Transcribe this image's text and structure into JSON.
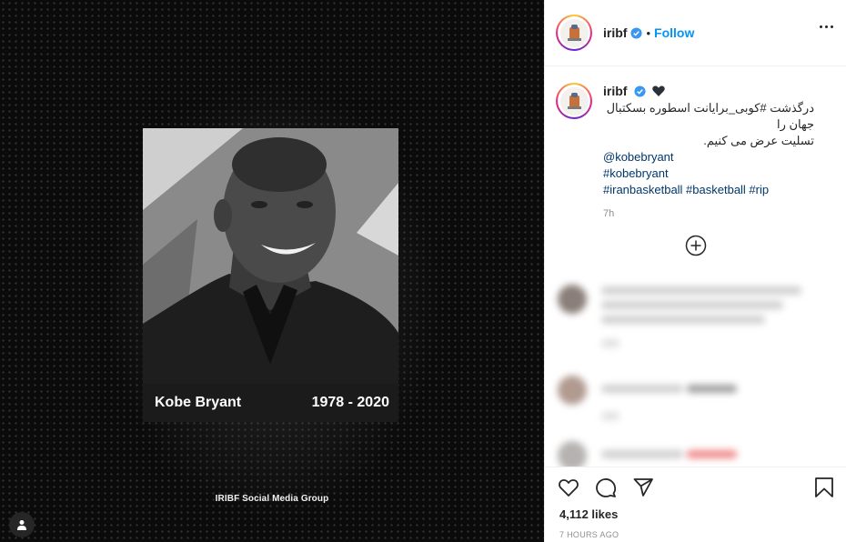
{
  "post": {
    "username": "iribf",
    "follow_label": "Follow",
    "dot": "•",
    "media": {
      "name_text": "Kobe Bryant",
      "years_text": "1978 - 2020",
      "watermark": "IRIBF Social Media Group",
      "icons": [
        "user-tag-icon"
      ]
    },
    "caption": {
      "username": "iribf",
      "lines": [
        "درگذشت #کوبی_برایانت اسطوره بسکتبال جهان را",
        "تسلیت عرض می کنیم."
      ],
      "mention": "@kobebryant",
      "hashtag_1": "#kobebryant",
      "hashtags_2": "#iranbasketball #basketball #rip",
      "time": "7h"
    },
    "likes": "4,112 likes",
    "time_ago": "7 HOURS AGO",
    "colors": {
      "accent": "#0095f6",
      "link": "#00376b",
      "text": "#262626",
      "muted": "#8e8e8e",
      "verified": "#3897f0"
    },
    "icons": [
      "verified-icon",
      "black-heart-icon",
      "more-options-icon",
      "load-more-comments-icon",
      "like-heart-icon",
      "comment-icon",
      "share-icon",
      "save-bookmark-icon"
    ]
  }
}
